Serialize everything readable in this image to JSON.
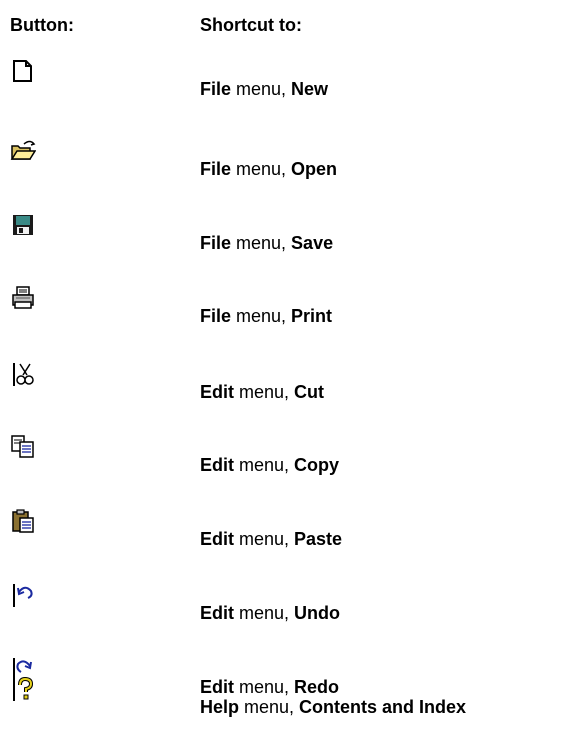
{
  "header": {
    "button_label": "Button:",
    "shortcut_label": "Shortcut to:"
  },
  "rows": [
    {
      "icon": "new-document-icon",
      "menu": "File",
      "sep": " menu, ",
      "command": "New"
    },
    {
      "icon": "open-folder-icon",
      "menu": "File",
      "sep": " menu, ",
      "command": "Open"
    },
    {
      "icon": "save-disk-icon",
      "menu": "File",
      "sep": " menu, ",
      "command": "Save"
    },
    {
      "icon": "print-icon",
      "menu": "File",
      "sep": " menu, ",
      "command": "Print"
    },
    {
      "icon": "cut-icon",
      "menu": "Edit",
      "sep": " menu, ",
      "command": "Cut"
    },
    {
      "icon": "copy-icon",
      "menu": "Edit",
      "sep": " menu, ",
      "command": "Copy"
    },
    {
      "icon": "paste-icon",
      "menu": "Edit",
      "sep": " menu, ",
      "command": "Paste"
    },
    {
      "icon": "undo-icon",
      "menu": "Edit",
      "sep": " menu, ",
      "command": "Undo"
    },
    {
      "icon": "redo-icon",
      "menu": "Edit",
      "sep": " menu, ",
      "command": "Redo"
    },
    {
      "icon": "help-icon",
      "menu": "Help",
      "sep": " menu, ",
      "command": "Contents and Index"
    }
  ]
}
